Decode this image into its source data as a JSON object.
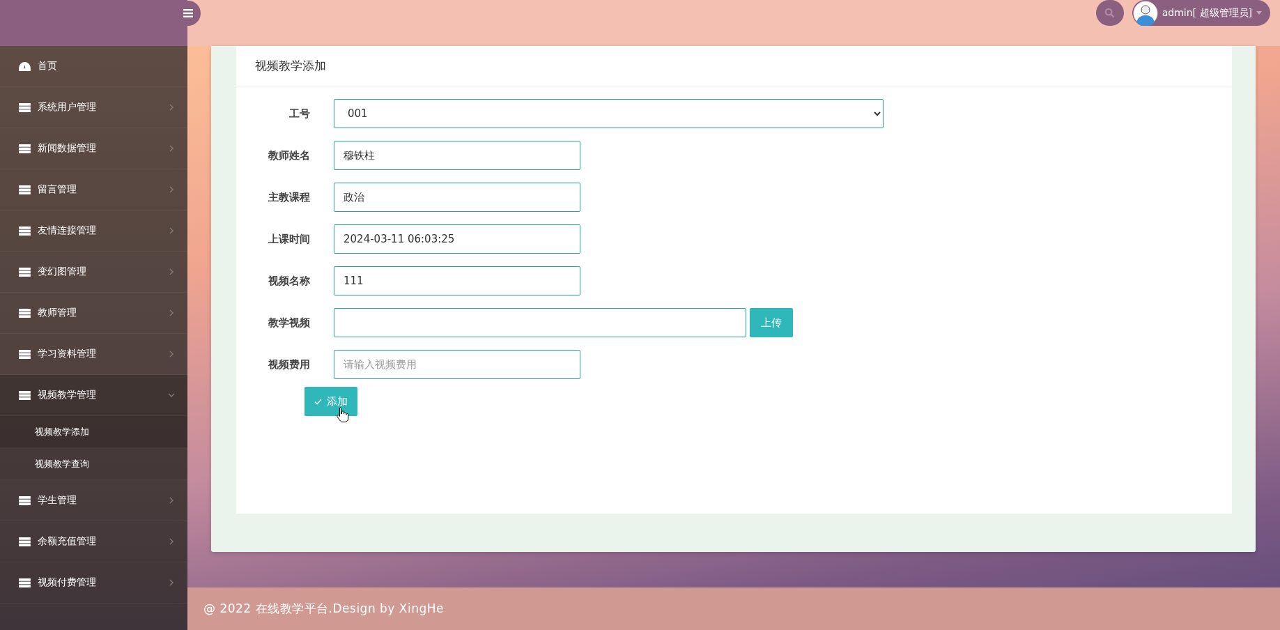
{
  "sidebar": {
    "items": [
      {
        "label": "首页",
        "kind": "dashboard",
        "expanded": false
      },
      {
        "label": "系统用户管理",
        "kind": "list",
        "expanded": false
      },
      {
        "label": "新闻数据管理",
        "kind": "list",
        "expanded": false
      },
      {
        "label": "留言管理",
        "kind": "list",
        "expanded": false
      },
      {
        "label": "友情连接管理",
        "kind": "list",
        "expanded": false
      },
      {
        "label": "变幻图管理",
        "kind": "list",
        "expanded": false
      },
      {
        "label": "教师管理",
        "kind": "list",
        "expanded": false
      },
      {
        "label": "学习资料管理",
        "kind": "list",
        "expanded": false
      },
      {
        "label": "视频教学管理",
        "kind": "list",
        "expanded": true,
        "children": [
          {
            "label": "视频教学添加",
            "selected": true
          },
          {
            "label": "视频教学查询",
            "selected": false
          }
        ]
      },
      {
        "label": "学生管理",
        "kind": "list",
        "expanded": false
      },
      {
        "label": "余额充值管理",
        "kind": "list",
        "expanded": false
      },
      {
        "label": "视频付费管理",
        "kind": "list",
        "expanded": false
      }
    ]
  },
  "header": {
    "user": "admin[ 超级管理员]"
  },
  "form": {
    "title": "视频教学添加",
    "fields": [
      {
        "label": "工号",
        "kind": "select",
        "value": "001"
      },
      {
        "label": "教师姓名",
        "kind": "text",
        "value": "穆铁柱"
      },
      {
        "label": "主教课程",
        "kind": "text",
        "value": "政治"
      },
      {
        "label": "上课时间",
        "kind": "text",
        "value": "2024-03-11 06:03:25"
      },
      {
        "label": "视频名称",
        "kind": "text",
        "value": "111"
      },
      {
        "label": "教学视频",
        "kind": "upload",
        "button": "上传"
      },
      {
        "label": "视频费用",
        "kind": "text",
        "placeholder": "请输入视频费用"
      }
    ],
    "submit": "添加"
  },
  "footer": "@ 2022 在线教学平台.Design by XingHe"
}
